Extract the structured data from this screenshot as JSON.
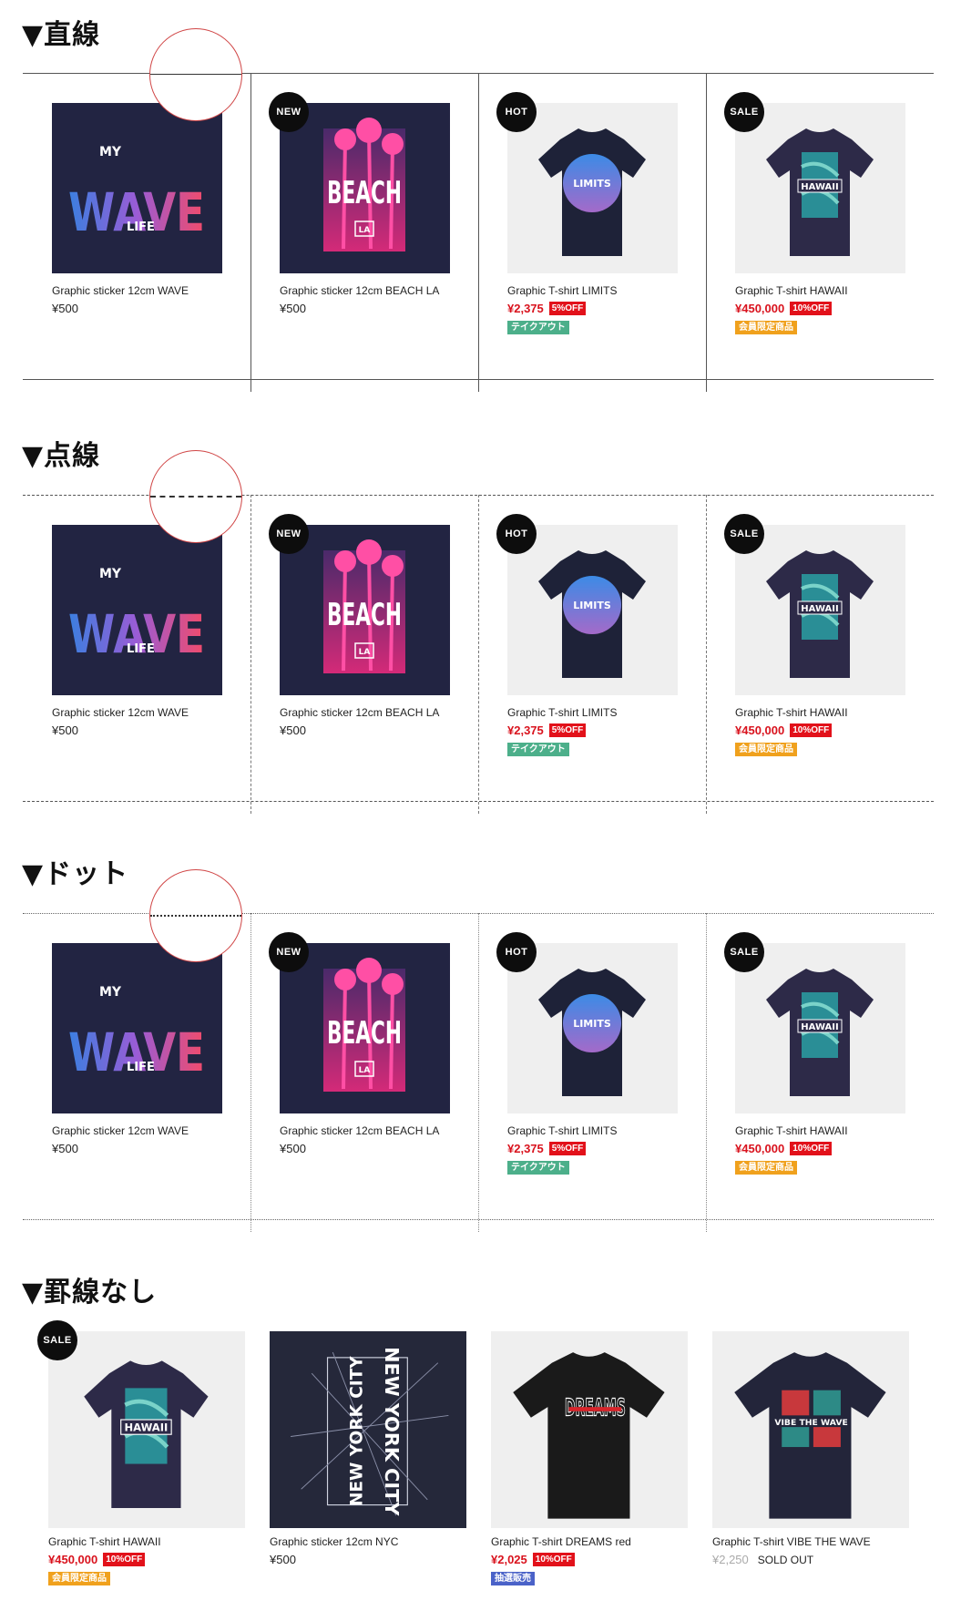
{
  "sections": [
    {
      "title": "▼直線"
    },
    {
      "title": "▼点線"
    },
    {
      "title": "▼ドット"
    },
    {
      "title": "▼罫線なし"
    }
  ],
  "grid_products": [
    {
      "name": "Graphic sticker 12cm WAVE",
      "price": "¥500"
    },
    {
      "name": "Graphic sticker 12cm BEACH LA",
      "price": "¥500",
      "badge": "NEW"
    },
    {
      "name": "Graphic T-shirt LIMITS",
      "price": "¥2,375",
      "discount": "5%OFF",
      "tag": "テイクアウト",
      "badge": "HOT"
    },
    {
      "name": "Graphic T-shirt HAWAII",
      "price": "¥450,000",
      "discount": "10%OFF",
      "tag": "会員限定商品",
      "badge": "SALE"
    }
  ],
  "noline_products": [
    {
      "name": "Graphic T-shirt HAWAII",
      "price": "¥450,000",
      "discount": "10%OFF",
      "tag": "会員限定商品",
      "badge": "SALE"
    },
    {
      "name": "Graphic sticker 12cm NYC",
      "price": "¥500"
    },
    {
      "name": "Graphic T-shirt DREAMS red",
      "price": "¥2,025",
      "discount": "10%OFF",
      "tag": "抽選販売"
    },
    {
      "name": "Graphic T-shirt VIBE THE WAVE",
      "price": "¥2,250",
      "status": "SOLD OUT"
    }
  ],
  "artwork_text": {
    "wave": "WAVE",
    "my": "MY",
    "life": "LIFE",
    "beach": "BEACH",
    "la": "LA",
    "limits": "LIMITS",
    "hawaii": "HAWAII",
    "nyc": "NEW YORK CITY",
    "dreams": "DREAMS",
    "vibe": "VIBE THE WAVE"
  },
  "colors": {
    "sale_red": "#d9121d",
    "badge_black": "#0d0d0d",
    "takeout_green": "#4caf8a",
    "member_orange": "#f0a11d",
    "lottery_blue": "#4a62c8"
  }
}
